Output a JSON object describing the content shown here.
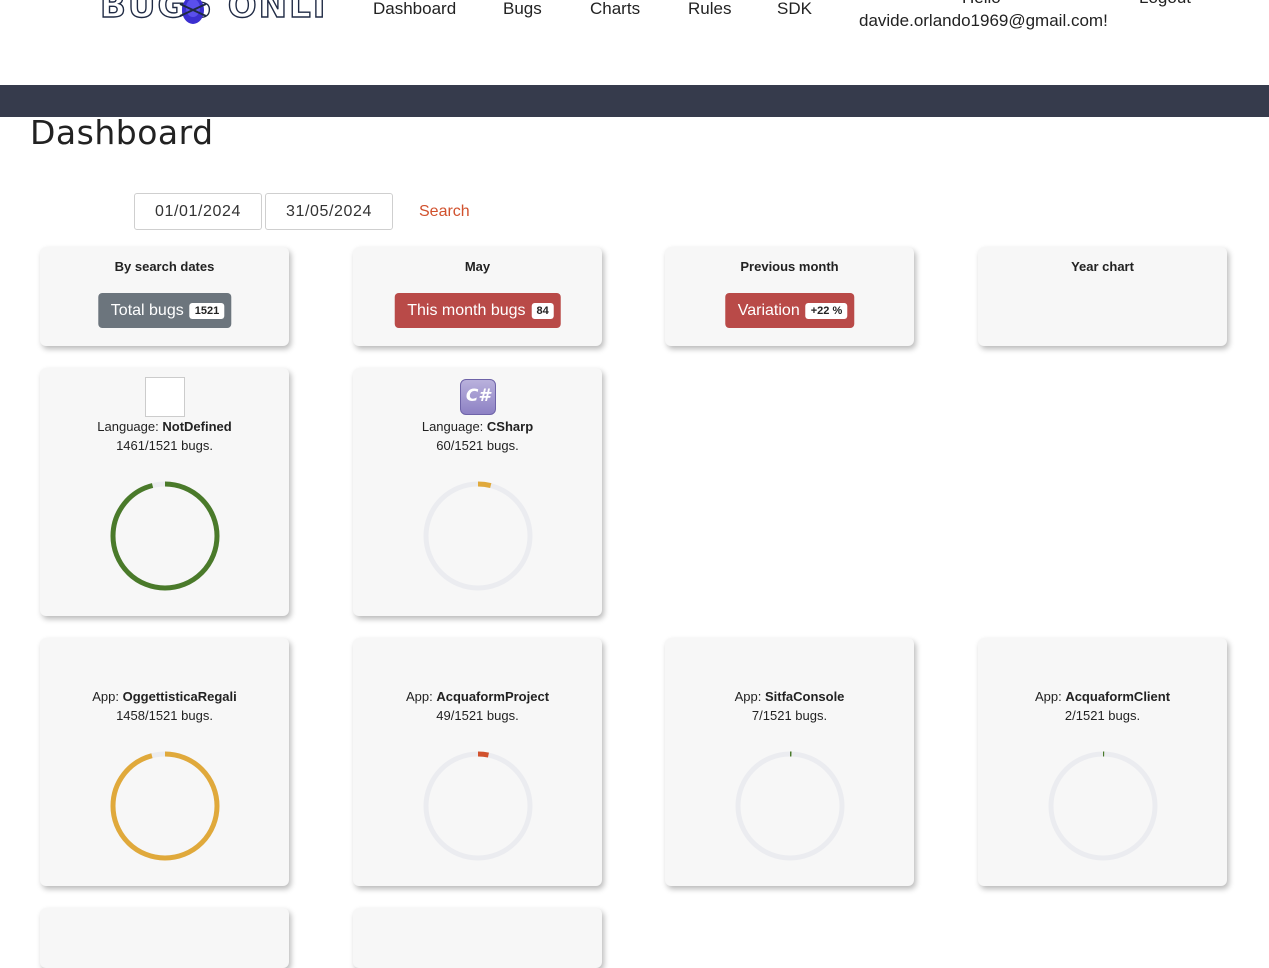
{
  "nav": {
    "logo_text": "BUGS ONLINE",
    "links": [
      "Dashboard",
      "Bugs",
      "Charts",
      "Rules",
      "SDK"
    ],
    "hello": "Hello",
    "email": "davide.orlando1969@gmail.com!",
    "logout": "Logout"
  },
  "page": {
    "title": "Dashboard"
  },
  "search": {
    "date_from": "01/01/2024",
    "date_to": "31/05/2024",
    "button": "Search"
  },
  "summary": [
    {
      "title": "By search dates",
      "label": "Total bugs",
      "badge": "1521",
      "color": "#6c757d"
    },
    {
      "title": "May",
      "label": "This month bugs",
      "badge": "84",
      "color": "#b94a48"
    },
    {
      "title": "Previous month",
      "label": "Variation",
      "badge": "+22 %",
      "color": "#b94a48"
    },
    {
      "title": "Year chart"
    }
  ],
  "languages": [
    {
      "prefix": "Language:",
      "name": "NotDefined",
      "count": "1461/1521 bugs.",
      "value": 1461,
      "total": 1521,
      "color": "#4a7a2a",
      "icon": "blank-icon"
    },
    {
      "prefix": "Language:",
      "name": "CSharp",
      "count": "60/1521 bugs.",
      "value": 60,
      "total": 1521,
      "color": "#e0a93b",
      "icon": "csharp-icon",
      "icon_text": "C#"
    }
  ],
  "apps": [
    {
      "prefix": "App:",
      "name": "OggettisticaRegali",
      "count": "1458/1521 bugs.",
      "value": 1458,
      "total": 1521,
      "color": "#e0a93b"
    },
    {
      "prefix": "App:",
      "name": "AcquaformProject",
      "count": "49/1521 bugs.",
      "value": 49,
      "total": 1521,
      "color": "#d1512d"
    },
    {
      "prefix": "App:",
      "name": "SitfaConsole",
      "count": "7/1521 bugs.",
      "value": 7,
      "total": 1521,
      "color": "#4a7a2a"
    },
    {
      "prefix": "App:",
      "name": "AcquaformClient",
      "count": "2/1521 bugs.",
      "value": 2,
      "total": 1521,
      "color": "#4a7a2a"
    }
  ],
  "colors": {
    "darkbar": "#363b4c",
    "accent": "#d1512d",
    "track": "#ebecf0"
  }
}
